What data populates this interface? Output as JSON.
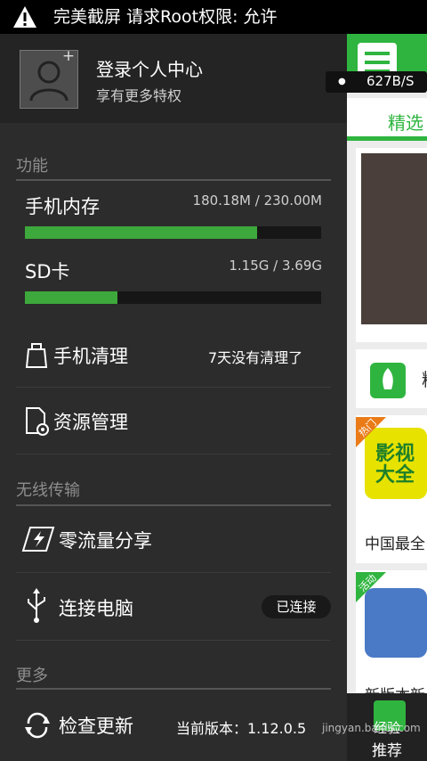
{
  "status_bar": {
    "notification": "完美截屏 请求Root权限: 允许",
    "icon": "warning-icon"
  },
  "profile": {
    "title": "登录个人中心",
    "subtitle": "享有更多特权",
    "plus": "+"
  },
  "sections": {
    "functions": "功能",
    "wireless": "无线传输",
    "more": "更多"
  },
  "storage": {
    "phone": {
      "label": "手机内存",
      "value": "180.18M / 230.00M",
      "fraction": 0.7834
    },
    "sd": {
      "label": "SD卡",
      "value": "1.15G / 3.69G",
      "fraction": 0.3117
    }
  },
  "menu": {
    "cleanup": {
      "label": "手机清理",
      "hint": "7天没有清理了",
      "icon": "clean-icon"
    },
    "resources": {
      "label": "资源管理",
      "icon": "file-gear-icon"
    },
    "share": {
      "label": "零流量分享",
      "icon": "flash-share-icon"
    },
    "connect": {
      "label": "连接电脑",
      "badge": "已连接",
      "icon": "usb-icon"
    },
    "update": {
      "label": "检查更新",
      "hint": "当前版本：1.12.0.5",
      "icon": "refresh-icon"
    }
  },
  "right_panel": {
    "speed": "627B/S",
    "tab_featured": "精选",
    "promo_text": "精",
    "app1_tag": "热门",
    "app1_icon_text": "影视大全",
    "app1_name": "中国最全",
    "app2_tag": "活动",
    "app2_name": "新版本新",
    "bottom_label": "推荐",
    "bottom_label_top": "经验",
    "watermark": "jingyan.baidu.com"
  },
  "colors": {
    "accent_green": "#3da83b",
    "brand_green": "#2fb53f",
    "drawer_bg": "#2c2c2c"
  }
}
